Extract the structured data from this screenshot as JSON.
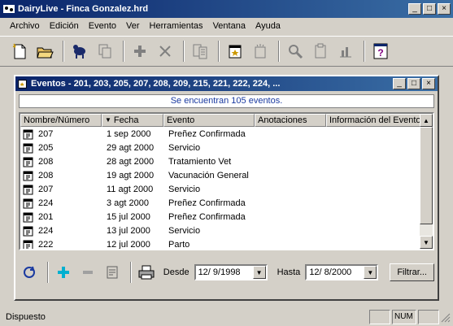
{
  "window": {
    "title": "DairyLive - Finca Gonzalez.hrd"
  },
  "menu": [
    "Archivo",
    "Edición",
    "Evento",
    "Ver",
    "Herramientas",
    "Ventana",
    "Ayuda"
  ],
  "child": {
    "title": "Eventos - 201, 203, 205, 207, 208, 209, 215, 221, 222, 224, ...",
    "banner": "Se encuentran 105 eventos."
  },
  "columns": [
    "Nombre/Número",
    "Fecha",
    "Evento",
    "Anotaciones",
    "Información del Evento"
  ],
  "rows": [
    {
      "num": "207",
      "fecha": "1 sep 2000",
      "evento": "Preñez Confirmada"
    },
    {
      "num": "205",
      "fecha": "29 agt 2000",
      "evento": "Servicio"
    },
    {
      "num": "208",
      "fecha": "28 agt 2000",
      "evento": "Tratamiento Vet"
    },
    {
      "num": "208",
      "fecha": "19 agt 2000",
      "evento": "Vacunación General"
    },
    {
      "num": "207",
      "fecha": "11 agt 2000",
      "evento": "Servicio"
    },
    {
      "num": "224",
      "fecha": "3 agt 2000",
      "evento": "Preñez Confirmada"
    },
    {
      "num": "201",
      "fecha": "15 jul 2000",
      "evento": "Preñez Confirmada"
    },
    {
      "num": "224",
      "fecha": "13 jul 2000",
      "evento": "Servicio"
    },
    {
      "num": "222",
      "fecha": "12 jul 2000",
      "evento": "Parto"
    }
  ],
  "filter": {
    "desde_label": "Desde",
    "desde_value": "12/ 9/1998",
    "hasta_label": "Hasta",
    "hasta_value": "12/ 8/2000",
    "button_label": "Filtrar..."
  },
  "status": {
    "text": "Dispuesto",
    "num": "NUM"
  },
  "colors": {
    "titlebar": "#0a246a",
    "face": "#d4d0c8",
    "banner_text": "#1a3aa0"
  }
}
